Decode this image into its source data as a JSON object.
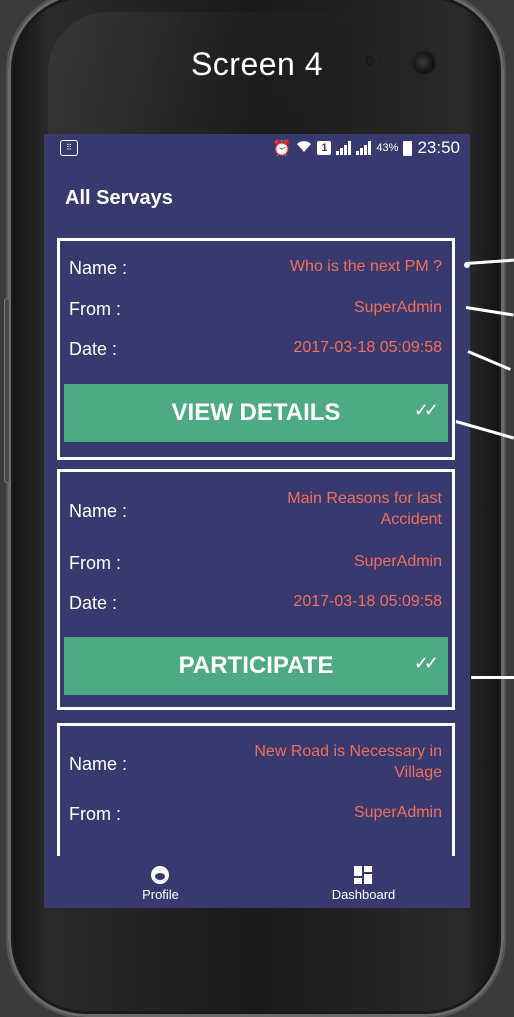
{
  "caption": "Screen 4",
  "statusbar": {
    "battery": "43%",
    "time": "23:50",
    "sim_label": "1"
  },
  "appbar": {
    "title": "All Servays"
  },
  "labels": {
    "name": "Name :",
    "from": "From :",
    "date": "Date :"
  },
  "cards": [
    {
      "name": "Who is the next PM ?",
      "from": "SuperAdmin",
      "date": "2017-03-18 05:09:58",
      "button": "VIEW DETAILS"
    },
    {
      "name": "Main Reasons for last Accident",
      "from": "SuperAdmin",
      "date": "2017-03-18 05:09:58",
      "button": "PARTICIPATE"
    },
    {
      "name": "New Road is Necessary in Village",
      "from": "SuperAdmin"
    }
  ],
  "bottomnav": {
    "profile": "Profile",
    "dashboard": "Dashboard"
  },
  "icons": {
    "check": "double-check-icon",
    "profile": "face-icon",
    "dashboard": "dashboard-icon"
  },
  "colors": {
    "background": "#38396e",
    "accent_value": "#f0705c",
    "button": "#4daa84"
  }
}
